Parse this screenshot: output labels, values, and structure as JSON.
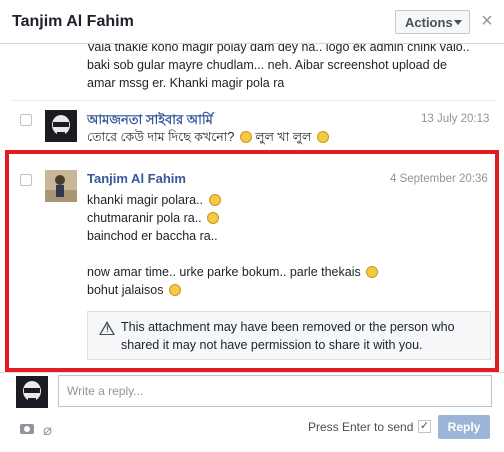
{
  "header": {
    "title": "Tanjim Al Fahim",
    "actions_label": "Actions",
    "close_glyph": "×"
  },
  "messages": [
    {
      "lines": [
        "Vala thakle kono magir polay dam dey na.. logo ek admin chink valo..",
        "baki sob gular mayre chudlam... neh. Aibar screenshot upload de",
        "amar mssg er. Khanki magir pola ra"
      ]
    },
    {
      "sender": "আমজনতা সাইবার আর্মি",
      "date": "13 July 20:13",
      "line": "তোরে কেউ দাম দিছে কখনো?",
      "line_tail": "লুল খা লুল",
      "avatar_icon": "skull-mask-icon"
    },
    {
      "sender": "Tanjim Al Fahim",
      "date": "4 September 20:36",
      "lines": [
        "khanki magir polara..",
        "chutmaranir pola ra..",
        "bainchod er baccha ra..",
        "now amar time.. urke parke bokum.. parle thekais",
        "bohut jalaisos"
      ],
      "avatar_icon": "person-photo-icon"
    }
  ],
  "notice": {
    "line1": "This attachment may have been removed or the person who",
    "line2": "shared it may not have permission to share it with you."
  },
  "composer": {
    "placeholder": "Write a reply...",
    "press_enter_label": "Press Enter to send",
    "reply_label": "Reply",
    "send_checked_glyph": "✓"
  },
  "colors": {
    "accent": "#365899",
    "highlight": "#e31b23",
    "reply_button": "#9cb4d8"
  }
}
